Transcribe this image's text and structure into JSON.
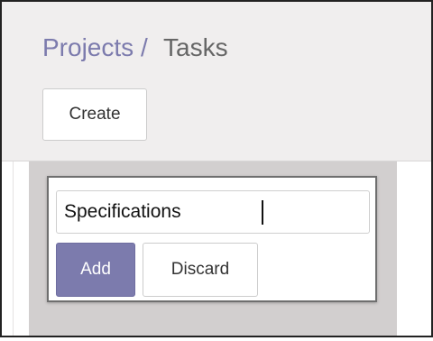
{
  "breadcrumb": {
    "parent": "Projects",
    "separator": "/",
    "current": "Tasks"
  },
  "toolbar": {
    "create_label": "Create"
  },
  "quick_create": {
    "name_value": "Specifications",
    "add_label": "Add",
    "discard_label": "Discard"
  },
  "colors": {
    "accent": "#7c7bad",
    "column_background": "#d2cfcf",
    "control_panel_background": "#f0eeee"
  }
}
